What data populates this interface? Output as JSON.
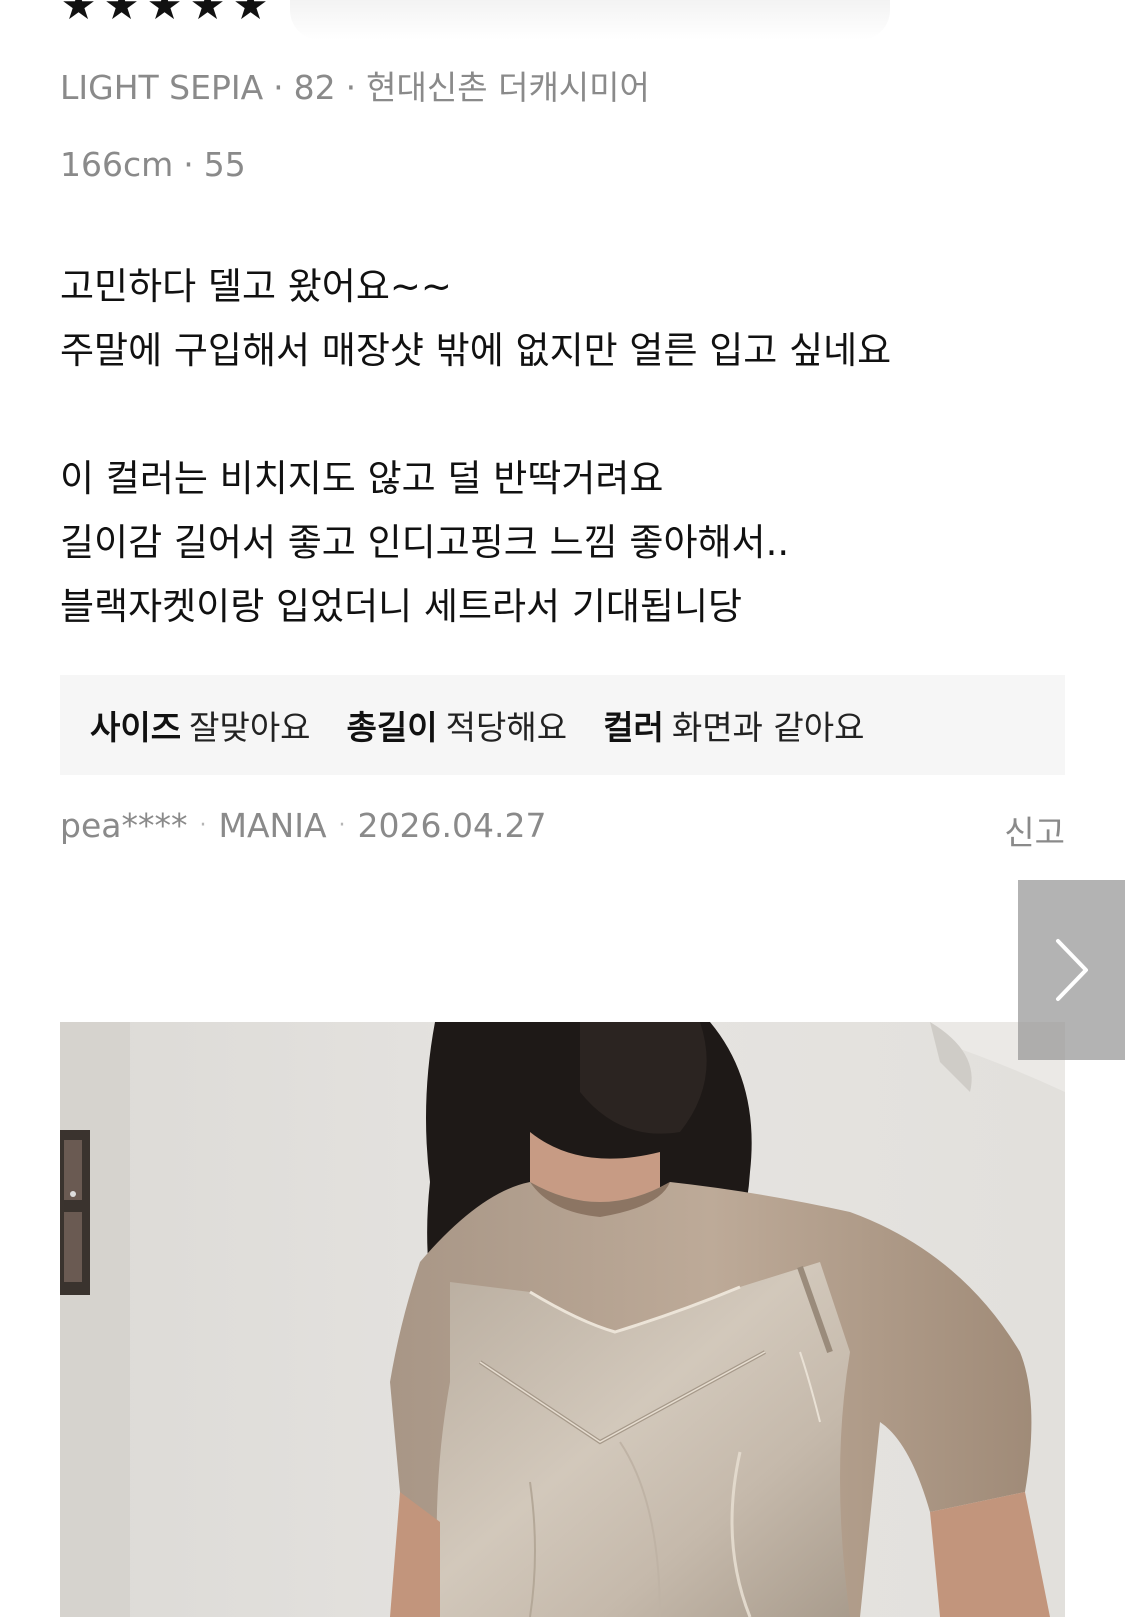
{
  "review": {
    "rating": 5,
    "stars": [
      "★",
      "★",
      "★",
      "★",
      "★"
    ],
    "option": {
      "color": "LIGHT SEPIA",
      "size": "82",
      "store": "현대신촌 더캐시미어",
      "separator": "·"
    },
    "body_info": {
      "height": "166cm",
      "size": "55"
    },
    "text_lines": [
      "고민하다 델고 왔어요~~",
      "주말에 구입해서 매장샷 밖에 없지만 얼른 입고 싶네요",
      "",
      "이 컬러는 비치지도 않고 덜 반딱거려요",
      "길이감 길어서 좋고 인디고핑크 느낌 좋아해서..",
      "블랙자켓이랑 입었더니 세트라서 기대됩니당"
    ],
    "attributes": [
      {
        "key": "사이즈",
        "value": "잘맞아요"
      },
      {
        "key": "총길이",
        "value": "적당해요"
      },
      {
        "key": "컬러",
        "value": "화면과 같아요"
      }
    ],
    "author": "pea****",
    "grade": "MANIA",
    "date": "2026.04.27",
    "report_label": "신고"
  },
  "icons": {
    "next": "chevron-right-icon",
    "star": "star-icon"
  },
  "colors": {
    "text_primary": "#111111",
    "text_muted": "#8a8a8a",
    "attr_bg": "#f6f6f6",
    "next_button_bg": "#969696"
  }
}
